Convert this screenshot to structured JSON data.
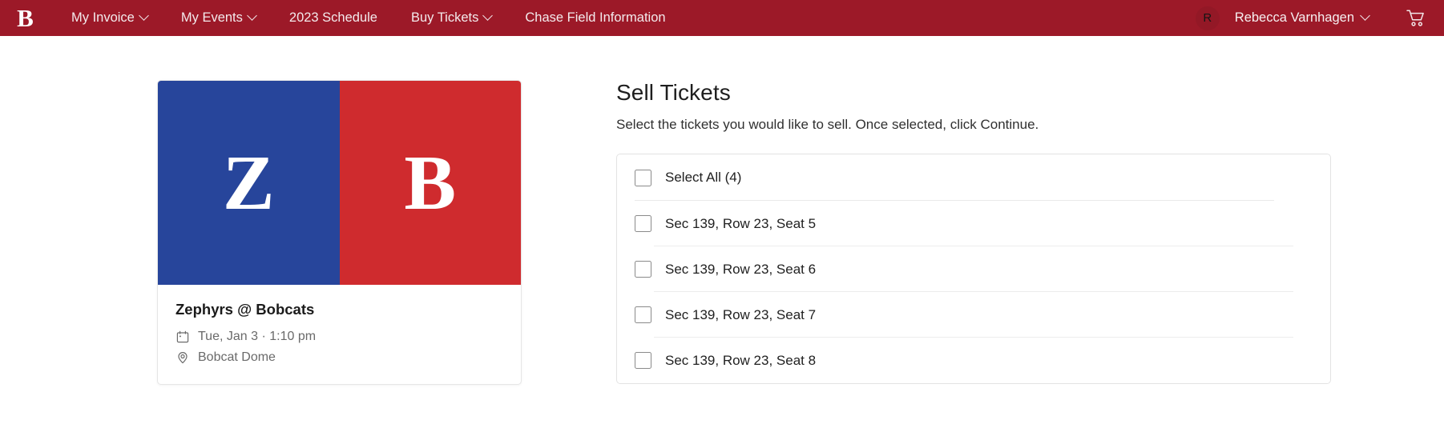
{
  "navbar": {
    "brand_letter": "B",
    "brand_icon": "bobcats-b-logo",
    "links": [
      {
        "label": "My Invoice",
        "has_chevron": true
      },
      {
        "label": "My Events",
        "has_chevron": true
      },
      {
        "label": "2023 Schedule",
        "has_chevron": false
      },
      {
        "label": "Buy Tickets",
        "has_chevron": true
      },
      {
        "label": "Chase Field Information",
        "has_chevron": false
      }
    ],
    "account": {
      "avatar_initial": "R",
      "name": "Rebecca Varnhagen",
      "has_chevron": true
    },
    "cart_icon": "shopping-cart-icon",
    "background_color": "#9c1928"
  },
  "event_card": {
    "hero": {
      "away_letter": "Z",
      "home_letter": "B",
      "away_color": "#27459b",
      "home_color": "#cf2b2e"
    },
    "title": "Zephyrs @ Bobcats",
    "date_icon": "calendar-icon",
    "date": "Tue, Jan 3 · 1:10 pm",
    "venue_icon": "location-pin-icon",
    "venue": "Bobcat Dome"
  },
  "sell": {
    "title": "Sell Tickets",
    "subtitle": "Select the tickets you would like to sell. Once selected, click Continue.",
    "select_all_label": "Select All (4)",
    "tickets": [
      {
        "label": "Sec 139, Row 23, Seat 5",
        "checked": false
      },
      {
        "label": "Sec 139, Row 23, Seat 6",
        "checked": false
      },
      {
        "label": "Sec 139, Row 23, Seat 7",
        "checked": false
      },
      {
        "label": "Sec 139, Row 23, Seat 8",
        "checked": false
      }
    ]
  }
}
